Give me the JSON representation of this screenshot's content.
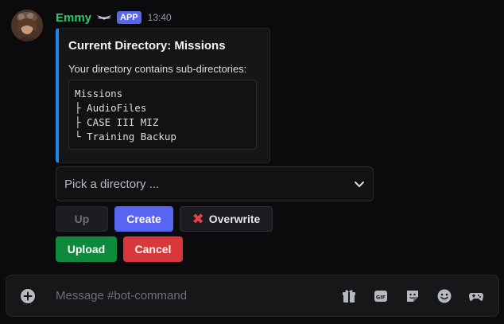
{
  "message": {
    "username": "Emmy",
    "app_badge": "APP",
    "timestamp": "13:40"
  },
  "embed": {
    "title": "Current Directory: Missions",
    "description": "Your directory contains sub-directories:",
    "tree_lines": [
      "Missions",
      "├ AudioFiles",
      "├ CASE III MIZ",
      "└ Training Backup"
    ],
    "accent_color": "#1e88e5"
  },
  "select": {
    "placeholder": "Pick a directory ..."
  },
  "buttons": {
    "up": "Up",
    "create": "Create",
    "overwrite": "Overwrite",
    "upload": "Upload",
    "cancel": "Cancel"
  },
  "composer": {
    "placeholder": "Message #bot-command",
    "icons": [
      "add-icon",
      "gift-icon",
      "gif-icon",
      "sticker-icon",
      "emoji-icon",
      "activities-icon"
    ]
  }
}
